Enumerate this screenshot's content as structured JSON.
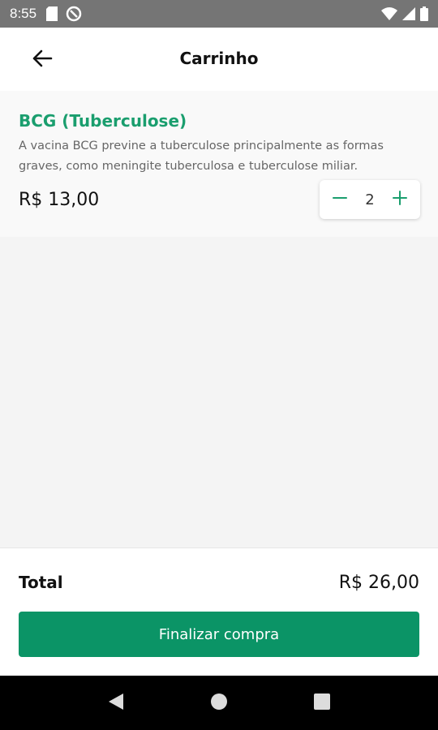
{
  "status_bar": {
    "time": "8:55",
    "icons": [
      "sd-card-icon",
      "do-not-disturb-icon",
      "wifi-icon",
      "signal-icon",
      "battery-icon"
    ]
  },
  "header": {
    "title": "Carrinho",
    "back_icon": "arrow-left-icon"
  },
  "cart": {
    "items": [
      {
        "name": "BCG (Tuberculose)",
        "description": "A vacina BCG previne a tuberculose principalmente as formas graves, como meningite tuberculosa e tuberculose miliar.",
        "price": "R$ 13,00",
        "quantity": "2"
      }
    ]
  },
  "footer": {
    "total_label": "Total",
    "total_value": "R$ 26,00",
    "checkout_label": "Finalizar compra"
  },
  "navigation": {
    "icons": [
      "back-triangle-icon",
      "home-circle-icon",
      "recents-square-icon"
    ]
  },
  "colors": {
    "accent": "#1a9e6e",
    "button": "#0b9466",
    "status_bar": "#757575"
  }
}
